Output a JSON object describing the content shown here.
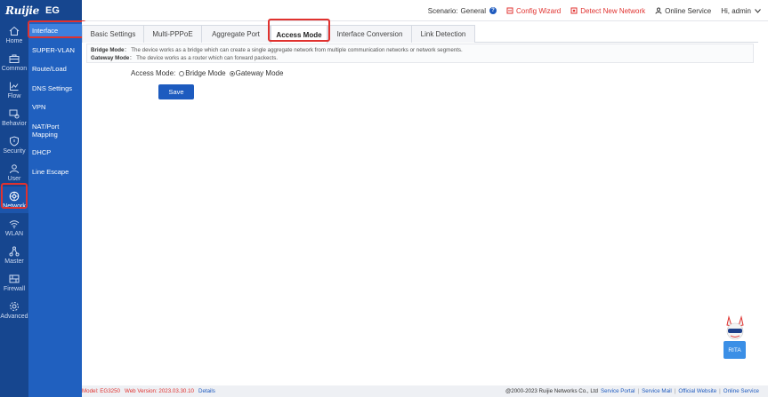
{
  "brand": {
    "logo": "Ruijie",
    "product": "EG"
  },
  "header": {
    "scenario_label": "Scenario:",
    "scenario_value": "General",
    "config_wizard": "Config Wizard",
    "detect_network": "Detect New Network",
    "online_service": "Online Service",
    "user_greeting": "Hi, admin"
  },
  "rail": {
    "items": [
      {
        "label": "Home",
        "icon": "home-icon"
      },
      {
        "label": "Common",
        "icon": "briefcase-icon"
      },
      {
        "label": "Flow",
        "icon": "chart-icon"
      },
      {
        "label": "Behavior",
        "icon": "behavior-icon"
      },
      {
        "label": "Security",
        "icon": "shield-icon"
      },
      {
        "label": "User",
        "icon": "user-icon"
      },
      {
        "label": "Network",
        "icon": "globe-icon",
        "active": true
      },
      {
        "label": "WLAN",
        "icon": "wifi-icon"
      },
      {
        "label": "Master",
        "icon": "topology-icon"
      },
      {
        "label": "Firewall",
        "icon": "firewall-icon"
      },
      {
        "label": "Advanced",
        "icon": "gear-icon"
      }
    ]
  },
  "submenu": {
    "items": [
      {
        "label": "Interface",
        "active": true
      },
      {
        "label": "SUPER-VLAN"
      },
      {
        "label": "Route/Load"
      },
      {
        "label": "DNS Settings"
      },
      {
        "label": "VPN"
      },
      {
        "label": "NAT/Port Mapping"
      },
      {
        "label": "DHCP"
      },
      {
        "label": "Line Escape"
      }
    ]
  },
  "tabs": [
    {
      "label": "Basic Settings"
    },
    {
      "label": "Multi-PPPoE"
    },
    {
      "label": "Aggregate Port"
    },
    {
      "label": "Access Mode",
      "active": true
    },
    {
      "label": "Interface Conversion"
    },
    {
      "label": "Link Detection"
    }
  ],
  "description": {
    "bridge_title": "Bridge Mode",
    "bridge_text": "The device works as a bridge which can create a single aggregate network from multiple communication networks or network segments.",
    "gateway_title": "Gateway Mode",
    "gateway_text": "The device works as a router which can forward packects."
  },
  "form": {
    "access_mode_label": "Access Mode:",
    "options": [
      "Bridge Mode",
      "Gateway Mode"
    ],
    "selected": "Gateway Mode",
    "save_label": "Save"
  },
  "footer": {
    "model_label": "Model: EG3250",
    "version_label": "Web Version: 2023.03.30.10",
    "details": "Details",
    "copyright": "@2000-2023 Ruijie Networks Co., Ltd",
    "links": [
      "Service Portal",
      "Service Mail",
      "Official Website",
      "Online Service"
    ]
  },
  "mascot": {
    "label": "RITA"
  },
  "colors": {
    "sidebar": "#16468f",
    "submenu": "#2060bf",
    "accent": "#1d5bbf",
    "highlight": "#e0322f"
  }
}
